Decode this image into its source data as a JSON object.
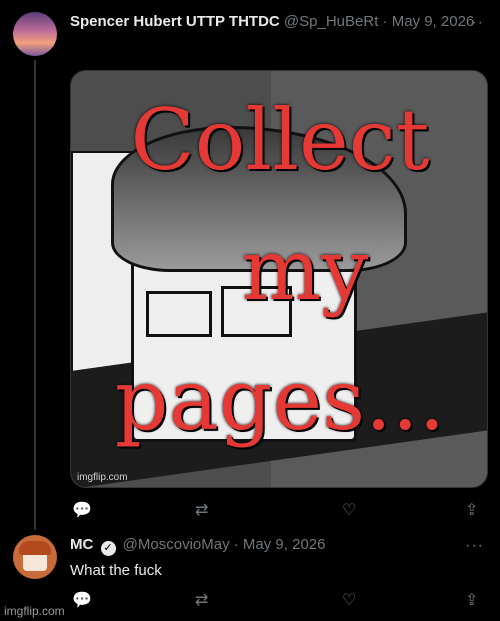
{
  "tweet1": {
    "display_name": "Spencer Hubert UTTP THTDC",
    "handle": "@Sp_HuBeRt",
    "date": "· May 9, 2026",
    "more": "···",
    "image": {
      "line1": "Collect",
      "line2": "my",
      "line3": "pages...",
      "watermark": "imgflip.com"
    },
    "actions": {
      "reply": "💬",
      "retweet": "⇄",
      "like": "♡",
      "share": "⇪"
    }
  },
  "tweet2": {
    "display_name": "MC",
    "verified": "✓",
    "handle": "@MoscovioMay",
    "date": "· May 9, 2026",
    "more": "···",
    "text": "What the fuck",
    "actions": {
      "reply": "💬",
      "retweet": "⇄",
      "like": "♡",
      "share": "⇪"
    }
  },
  "watermark": "imgflip.com"
}
